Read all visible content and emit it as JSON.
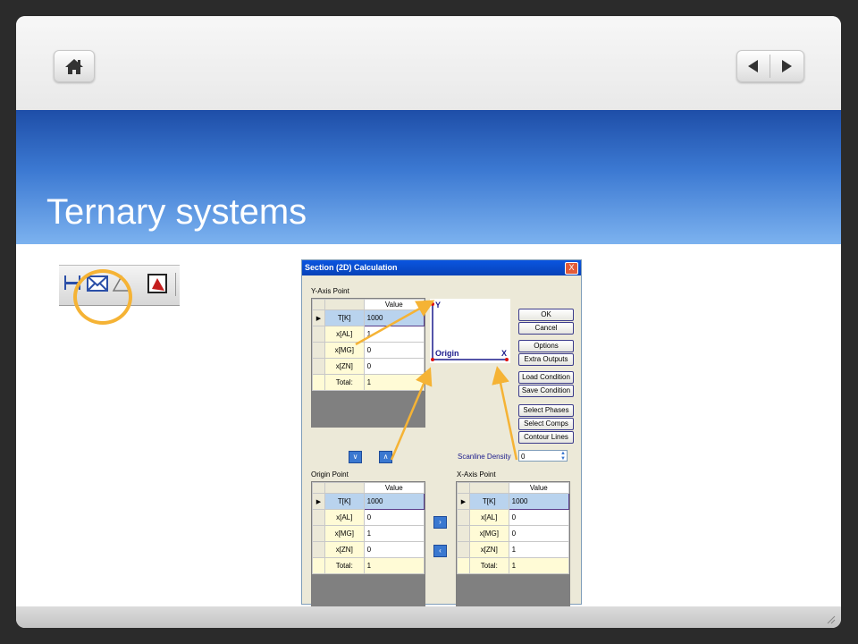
{
  "slide": {
    "title": "Ternary systems"
  },
  "nav": {
    "home_icon": "home-icon",
    "prev_icon": "prev-arrow-icon",
    "next_icon": "next-arrow-icon"
  },
  "colors": {
    "accent": "#3c79d2",
    "highlight": "#f5b335",
    "dialog_title": "#0a55e0"
  },
  "dialog": {
    "title": "Section (2D) Calculation",
    "close": "X",
    "y_axis": {
      "label": "Y-Axis Point",
      "header": "Value",
      "rows": [
        {
          "name": "T[K]",
          "value": "1000"
        },
        {
          "name": "x[AL]",
          "value": "1"
        },
        {
          "name": "x[MG]",
          "value": "0"
        },
        {
          "name": "x[ZN]",
          "value": "0"
        },
        {
          "name": "Total:",
          "value": "1"
        }
      ]
    },
    "origin": {
      "label": "Origin Point",
      "header": "Value",
      "rows": [
        {
          "name": "T[K]",
          "value": "1000"
        },
        {
          "name": "x[AL]",
          "value": "0"
        },
        {
          "name": "x[MG]",
          "value": "1"
        },
        {
          "name": "x[ZN]",
          "value": "0"
        },
        {
          "name": "Total:",
          "value": "1"
        }
      ]
    },
    "x_axis": {
      "label": "X-Axis Point",
      "header": "Value",
      "rows": [
        {
          "name": "T[K]",
          "value": "1000"
        },
        {
          "name": "x[AL]",
          "value": "0"
        },
        {
          "name": "x[MG]",
          "value": "0"
        },
        {
          "name": "x[ZN]",
          "value": "1"
        },
        {
          "name": "Total:",
          "value": "1"
        }
      ]
    },
    "preview": {
      "y": "Y",
      "x": "X",
      "origin": "Origin"
    },
    "buttons": [
      "OK",
      "Cancel",
      "Options",
      "Extra Outputs",
      "Load Condition",
      "Save Condition",
      "Select Phases",
      "Select Comps",
      "Contour Lines"
    ],
    "scanline": {
      "label": "Scanline Density",
      "value": "0"
    }
  }
}
